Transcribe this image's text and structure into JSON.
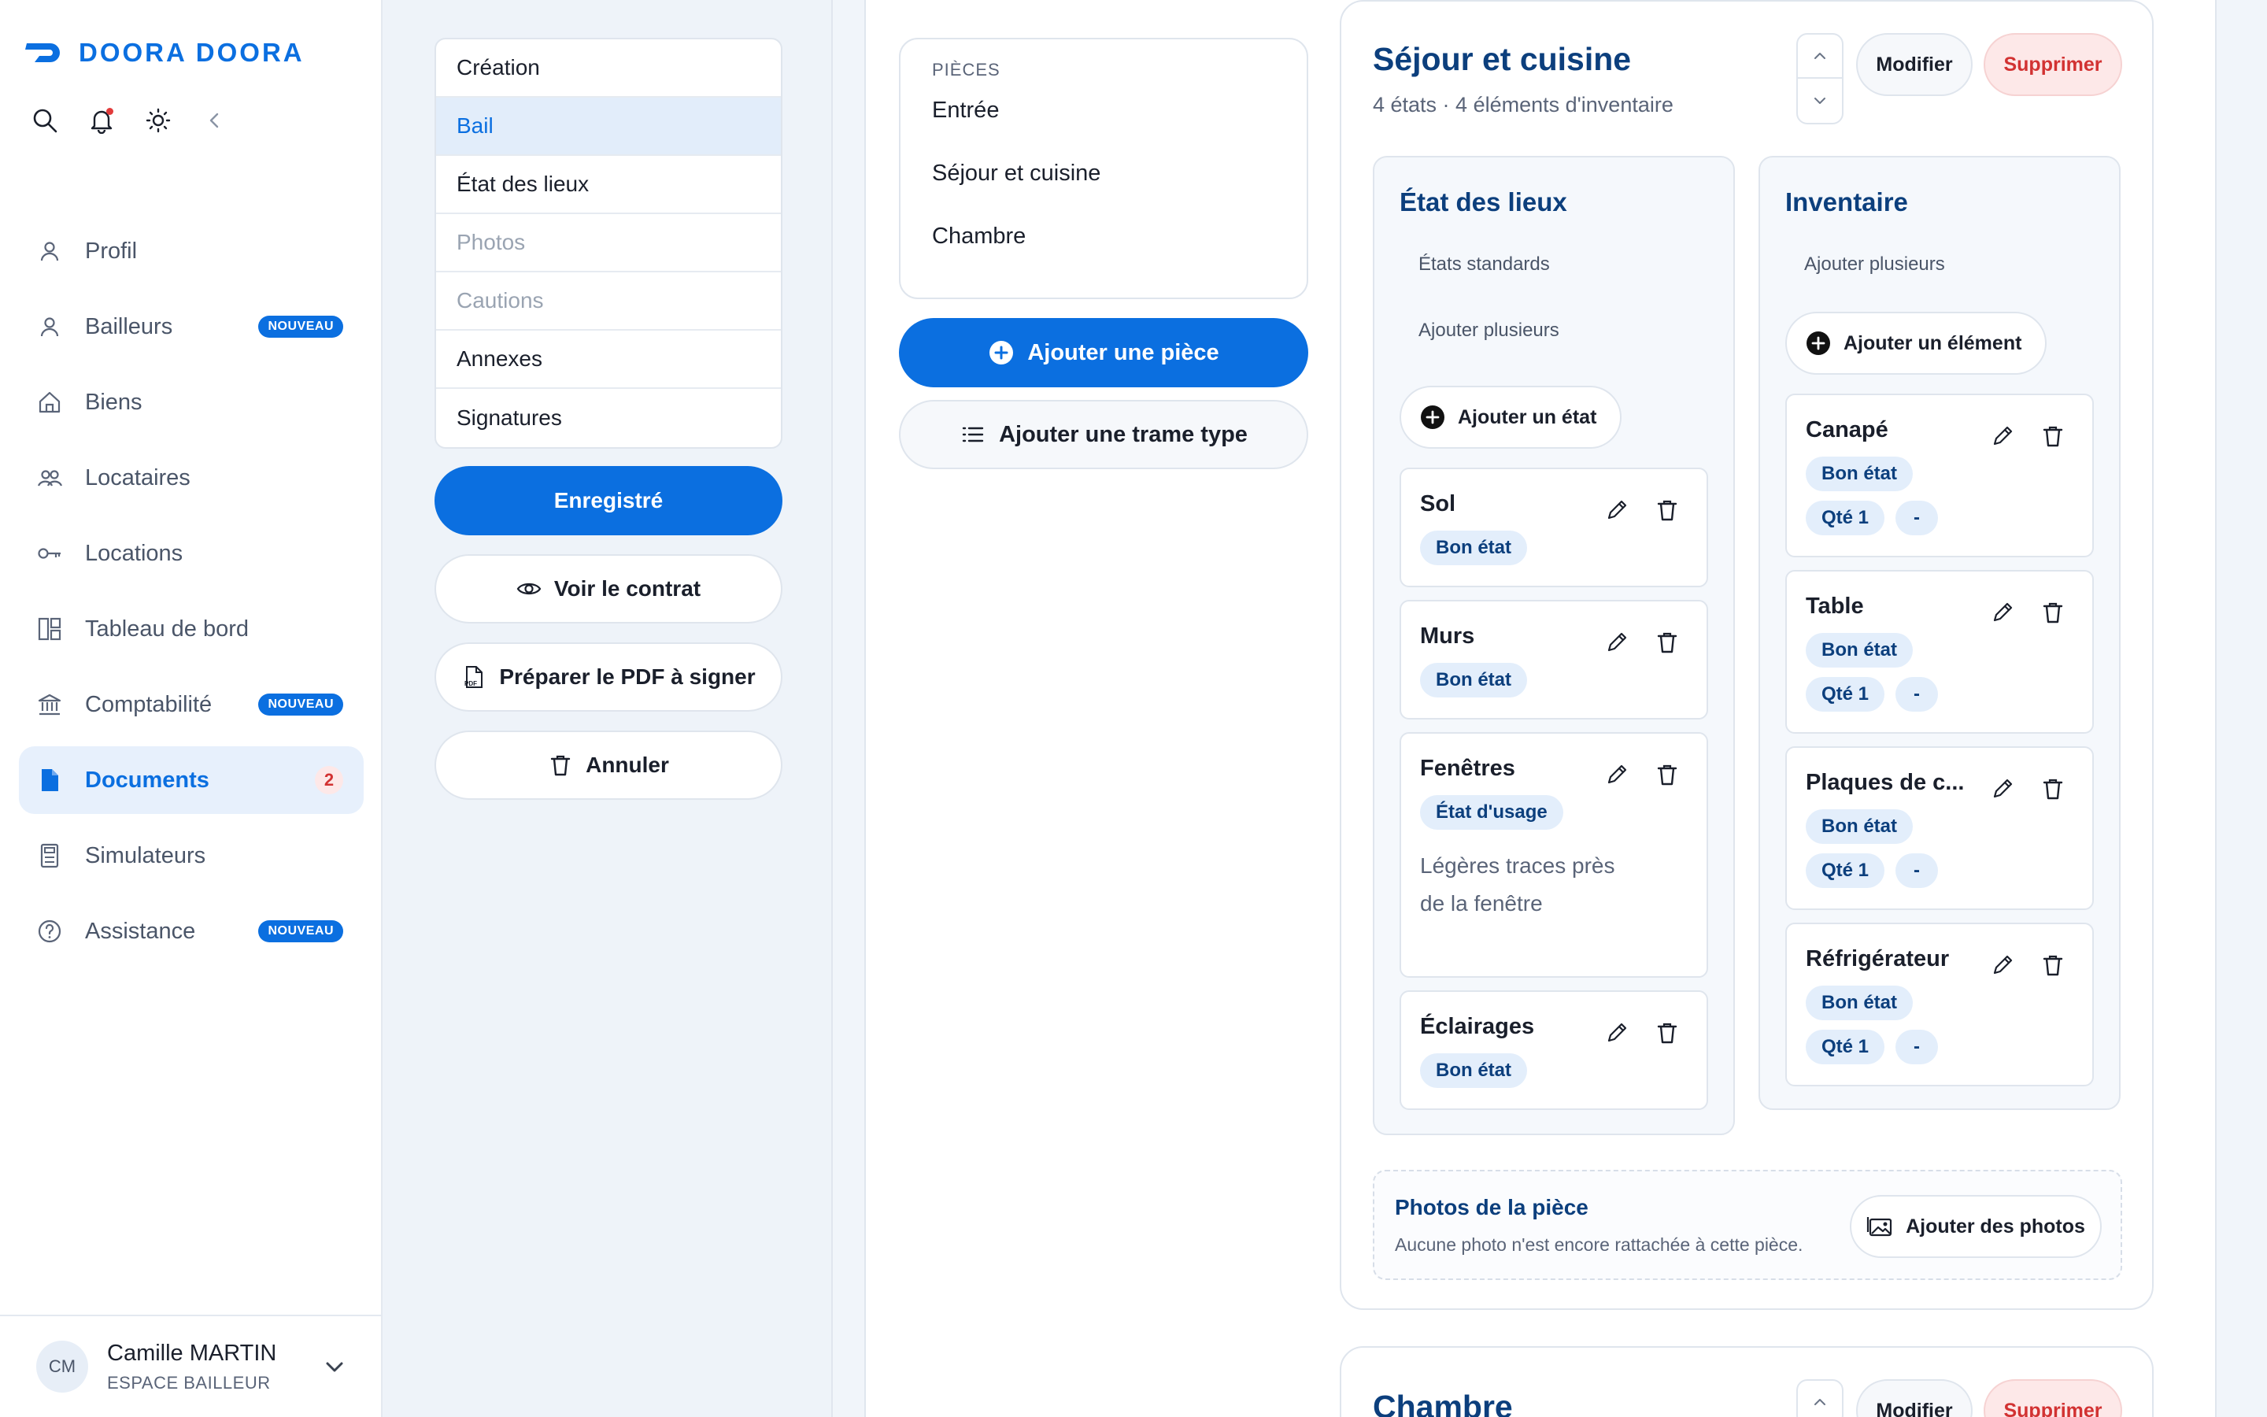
{
  "brand": {
    "name": "DOORA DOORA",
    "color": "#0b6fe0"
  },
  "top_icons": [
    "search-icon",
    "bell-icon",
    "sun-icon",
    "chevron-left-icon"
  ],
  "nav": {
    "items": [
      {
        "label": "Profil",
        "icon": "user-icon"
      },
      {
        "label": "Bailleurs",
        "icon": "user-icon",
        "badge": "NOUVEAU"
      },
      {
        "label": "Biens",
        "icon": "home-icon"
      },
      {
        "label": "Locataires",
        "icon": "users-icon"
      },
      {
        "label": "Locations",
        "icon": "key-icon"
      },
      {
        "label": "Tableau de bord",
        "icon": "dashboard-icon"
      },
      {
        "label": "Comptabilité",
        "icon": "bank-icon",
        "badge": "NOUVEAU"
      },
      {
        "label": "Documents",
        "icon": "document-icon",
        "count": "2",
        "active": true
      },
      {
        "label": "Simulateurs",
        "icon": "calculator-icon"
      },
      {
        "label": "Assistance",
        "icon": "help-icon",
        "badge": "NOUVEAU"
      }
    ]
  },
  "user": {
    "initials": "CM",
    "name": "Camille MARTIN",
    "role": "ESPACE BAILLEUR"
  },
  "steps": [
    {
      "label": "Création",
      "state": "normal"
    },
    {
      "label": "Bail",
      "state": "active"
    },
    {
      "label": "État des lieux",
      "state": "normal"
    },
    {
      "label": "Photos",
      "state": "disabled"
    },
    {
      "label": "Cautions",
      "state": "disabled"
    },
    {
      "label": "Annexes",
      "state": "normal"
    },
    {
      "label": "Signatures",
      "state": "normal"
    }
  ],
  "doc_actions": {
    "saved": "Enregistré",
    "view_contract": "Voir le contrat",
    "prepare_pdf": "Préparer le PDF à signer",
    "cancel": "Annuler"
  },
  "rooms": {
    "title": "PIÈCES",
    "items": [
      "Entrée",
      "Séjour et cuisine",
      "Chambre"
    ],
    "add_room": "Ajouter une pièce",
    "add_template": "Ajouter une trame type"
  },
  "room_detail": {
    "title": "Séjour et cuisine",
    "subtitle": "4 états · 4 éléments d'inventaire",
    "modify": "Modifier",
    "delete": "Supprimer",
    "states_panel": {
      "title": "État des lieux",
      "standard_link": "États standards",
      "add_multiple": "Ajouter plusieurs",
      "add_button": "Ajouter un état",
      "items": [
        {
          "name": "Sol",
          "tag": "Bon état"
        },
        {
          "name": "Murs",
          "tag": "Bon état"
        },
        {
          "name": "Fenêtres",
          "tag": "État d'usage",
          "note": "Légères traces près de la fenêtre"
        },
        {
          "name": "Éclairages",
          "tag": "Bon état"
        }
      ]
    },
    "inventory_panel": {
      "title": "Inventaire",
      "add_multiple": "Ajouter plusieurs",
      "add_button": "Ajouter un élément",
      "items": [
        {
          "name": "Canapé",
          "tag": "Bon état",
          "qty": "Qté 1",
          "extra": "-"
        },
        {
          "name": "Table",
          "tag": "Bon état",
          "qty": "Qté 1",
          "extra": "-"
        },
        {
          "name": "Plaques de c...",
          "tag": "Bon état",
          "qty": "Qté 1",
          "extra": "-"
        },
        {
          "name": "Réfrigérateur",
          "tag": "Bon état",
          "qty": "Qté 1",
          "extra": "-"
        }
      ]
    },
    "photos": {
      "title": "Photos de la pièce",
      "subtitle": "Aucune photo n'est encore rattachée à cette pièce.",
      "button": "Ajouter des photos"
    }
  },
  "next_room": {
    "title": "Chambre",
    "modify": "Modifier",
    "delete": "Supprimer"
  },
  "colors": {
    "accent": "#0b6fe0",
    "heading": "#0c3f7d",
    "danger": "#d23232",
    "tag_bg": "#e3eefb"
  }
}
